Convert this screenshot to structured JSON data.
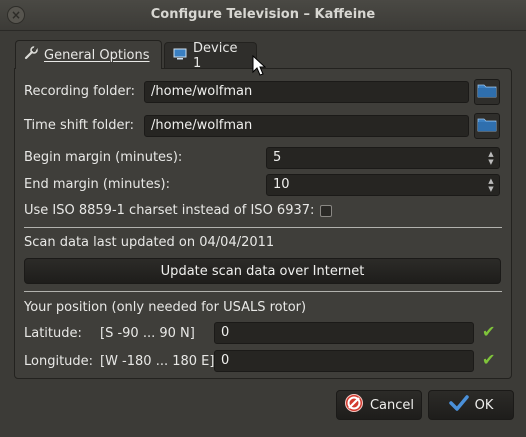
{
  "window": {
    "title": "Configure Television – Kaffeine"
  },
  "tabs": [
    {
      "label": "General Options",
      "icon": "wrench-icon",
      "active": true
    },
    {
      "label": "Device 1",
      "icon": "monitor-icon",
      "active": false
    }
  ],
  "general": {
    "recording_folder_label": "Recording folder:",
    "recording_folder_value": "/home/wolfman",
    "timeshift_folder_label": "Time shift folder:",
    "timeshift_folder_value": "/home/wolfman",
    "begin_margin_label": "Begin margin (minutes):",
    "begin_margin_value": "5",
    "end_margin_label": "End margin (minutes):",
    "end_margin_value": "10",
    "iso_charset_label": "Use ISO 8859-1 charset instead of ISO 6937:",
    "iso_charset_checked": false,
    "scan_updated_label": "Scan data last updated on 04/04/2011",
    "update_scan_button": "Update scan data over Internet",
    "position_header": "Your position (only needed for USALS rotor)",
    "latitude_label": "Latitude:",
    "latitude_range": "[S -90 ... 90 N]",
    "latitude_value": "0",
    "longitude_label": "Longitude:",
    "longitude_range": "[W -180 ... 180 E]",
    "longitude_value": "0"
  },
  "footer": {
    "cancel_label": "Cancel",
    "ok_label": "OK"
  },
  "colors": {
    "background": "#3c3b37",
    "field_bg": "#262522",
    "valid_check": "#7fc43a",
    "folder_icon": "#3a7fc1",
    "cancel_icon": "#d23a2e",
    "ok_icon": "#4a90d9"
  }
}
